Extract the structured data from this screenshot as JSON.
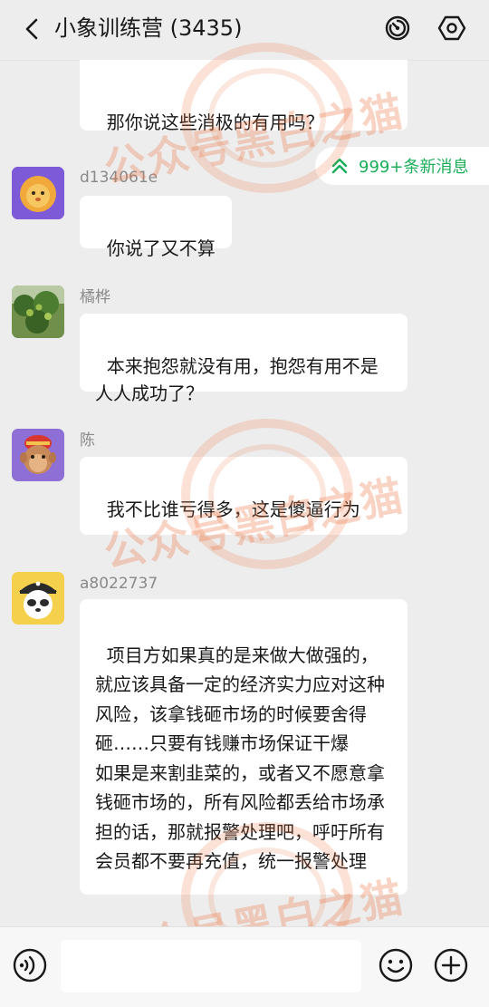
{
  "header": {
    "title": "小象训练营 (3435)"
  },
  "new_messages_label": "999+条新消息",
  "messages": [
    {
      "text": "那你说这些消极的有用吗？"
    },
    {
      "sender": "d134061e",
      "text": "你说了又不算"
    },
    {
      "sender": "橘桦",
      "text": "本来抱怨就没有用，抱怨有用不是人人成功了？"
    },
    {
      "sender": "陈",
      "text": "我不比谁亏得多，这是傻逼行为",
      "emoji": "laughing-tears-emoji"
    },
    {
      "sender": "a8022737",
      "text": "项目方如果真的是来做大做强的，就应该具备一定的经济实力应对这种风险，该拿钱砸市场的时候要舍得砸……只要有钱赚市场保证干爆\n如果是来割韭菜的，或者又不愿意拿钱砸市场的，所有风险都丢给市场承担的话，那就报警处理吧，呼吁所有会员都不要再充值，统一报警处理"
    }
  ],
  "input": {
    "value": "",
    "placeholder": ""
  },
  "watermark": "公众号黑白之猫",
  "colors": {
    "background": "#ededed",
    "bubble": "#ffffff",
    "accent_green": "#1aad5a",
    "watermark": "#eb7846"
  },
  "icons": {
    "back": "chevron-left-icon",
    "speed": "speedometer-icon",
    "settings": "hexagon-settings-icon",
    "voice": "voice-icon",
    "emoji": "smiley-icon",
    "plus": "plus-icon"
  }
}
